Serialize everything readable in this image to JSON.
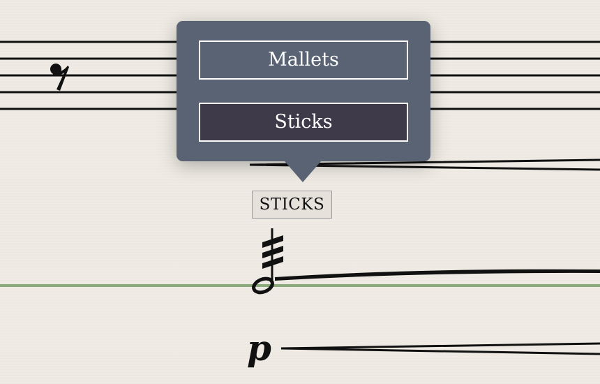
{
  "popover": {
    "options": [
      {
        "label": "Mallets",
        "selected": false
      },
      {
        "label": "Sticks",
        "selected": true
      }
    ]
  },
  "score": {
    "technique_text": "STICKS",
    "dynamic": "p",
    "highlight_color": "#8aab7a",
    "popover_color": "#596373",
    "selected_color": "#3e3a4a"
  }
}
